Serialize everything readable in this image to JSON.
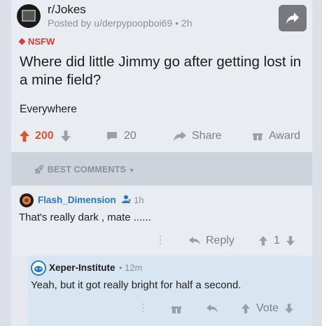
{
  "post": {
    "subreddit": "r/Jokes",
    "meta": "Posted by u/derpypoopboi69 • 2h",
    "nsfw": "NSFW",
    "title": "Where did little Jimmy go after getting lost in a mine field?",
    "body": "Everywhere",
    "score": "200",
    "comments": "20",
    "share": "Share",
    "award": "Award"
  },
  "comments_header": {
    "label": "BEST COMMENTS"
  },
  "comment1": {
    "user": "Flash_Dimension",
    "time": "• 1h",
    "text": "That's really dark , mate ......",
    "reply": "Reply",
    "score": "1"
  },
  "comment2": {
    "user": "Xeper-Institute",
    "time": "• 12m",
    "text": "Yeah, but it got really bright for half a second.",
    "vote": "Vote"
  },
  "colors": {
    "upvote": "#e0542b",
    "nsfw": "#d93a3a",
    "link": "#2878c8",
    "reply_bg": "#d7e6f0"
  }
}
